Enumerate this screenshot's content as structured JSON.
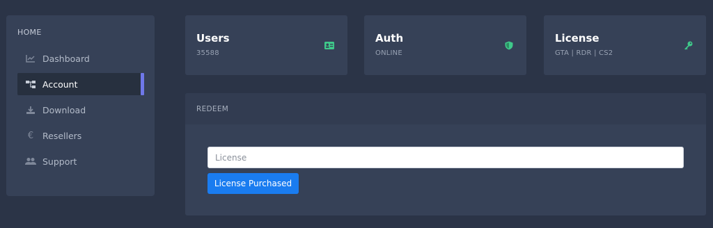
{
  "sidebar": {
    "heading": "HOME",
    "items": [
      {
        "label": "Dashboard",
        "icon": "chart-line-icon"
      },
      {
        "label": "Account",
        "icon": "sitemap-icon",
        "active": true
      },
      {
        "label": "Download",
        "icon": "download-icon"
      },
      {
        "label": "Resellers",
        "icon": "euro-icon"
      },
      {
        "label": "Support",
        "icon": "users-icon"
      }
    ]
  },
  "cards": [
    {
      "title": "Users",
      "subtitle": "35588",
      "icon": "id-card-icon"
    },
    {
      "title": "Auth",
      "subtitle": "ONLINE",
      "icon": "shield-icon"
    },
    {
      "title": "License",
      "subtitle": "GTA | RDR | CS2",
      "icon": "key-icon"
    }
  ],
  "redeem": {
    "header": "REDEEM",
    "input_placeholder": "License",
    "input_value": "",
    "button_label": "License Purchased"
  },
  "colors": {
    "background": "#2b3447",
    "card": "#364157",
    "accent_bar": "#6f78e9",
    "icon_green": "#3fc98a",
    "button": "#1a7cf0"
  }
}
